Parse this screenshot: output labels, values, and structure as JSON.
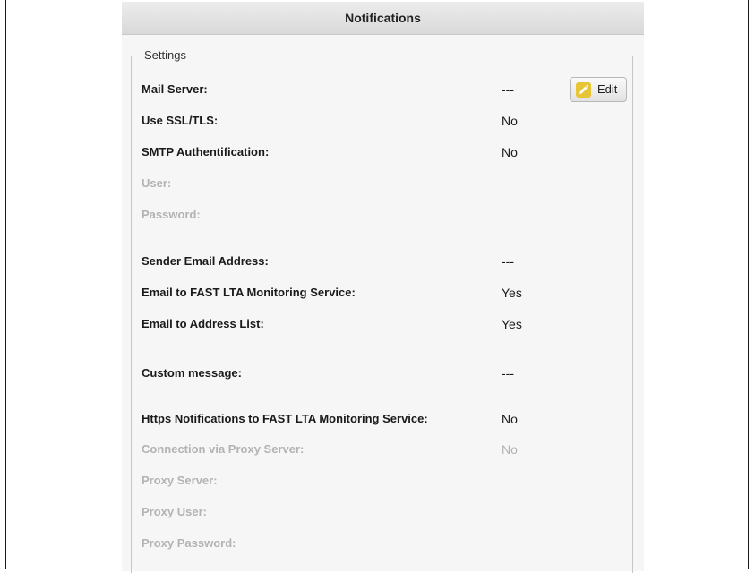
{
  "window": {
    "title": "Notifications"
  },
  "settings": {
    "legend": "Settings",
    "edit_label": "Edit",
    "rows": [
      {
        "label": "Mail Server:",
        "value": "---"
      },
      {
        "label": "Use SSL/TLS:",
        "value": "No"
      },
      {
        "label": "SMTP Authentification:",
        "value": "No"
      },
      {
        "label": "User:",
        "value": "",
        "disabled": true
      },
      {
        "label": "Password:",
        "value": "",
        "disabled": true
      },
      {
        "label": "Sender Email Address:",
        "value": "---"
      },
      {
        "label": "Email to FAST LTA Monitoring Service:",
        "value": "Yes"
      },
      {
        "label": "Email to Address List:",
        "value": "Yes"
      },
      {
        "label": "Custom message:",
        "value": "---"
      },
      {
        "label": "Https Notifications to FAST LTA Monitoring Service:",
        "value": "No"
      },
      {
        "label": "Connection via Proxy Server:",
        "value": "No",
        "disabled": true
      },
      {
        "label": "Proxy Server:",
        "value": "",
        "disabled": true
      },
      {
        "label": "Proxy User:",
        "value": "",
        "disabled": true
      },
      {
        "label": "Proxy Password:",
        "value": "",
        "disabled": true
      }
    ]
  },
  "icons": {
    "edit": "pencil-icon"
  },
  "colors": {
    "edit_icon_bg": "#e7c534",
    "disabled_text": "#b3b3b3"
  }
}
